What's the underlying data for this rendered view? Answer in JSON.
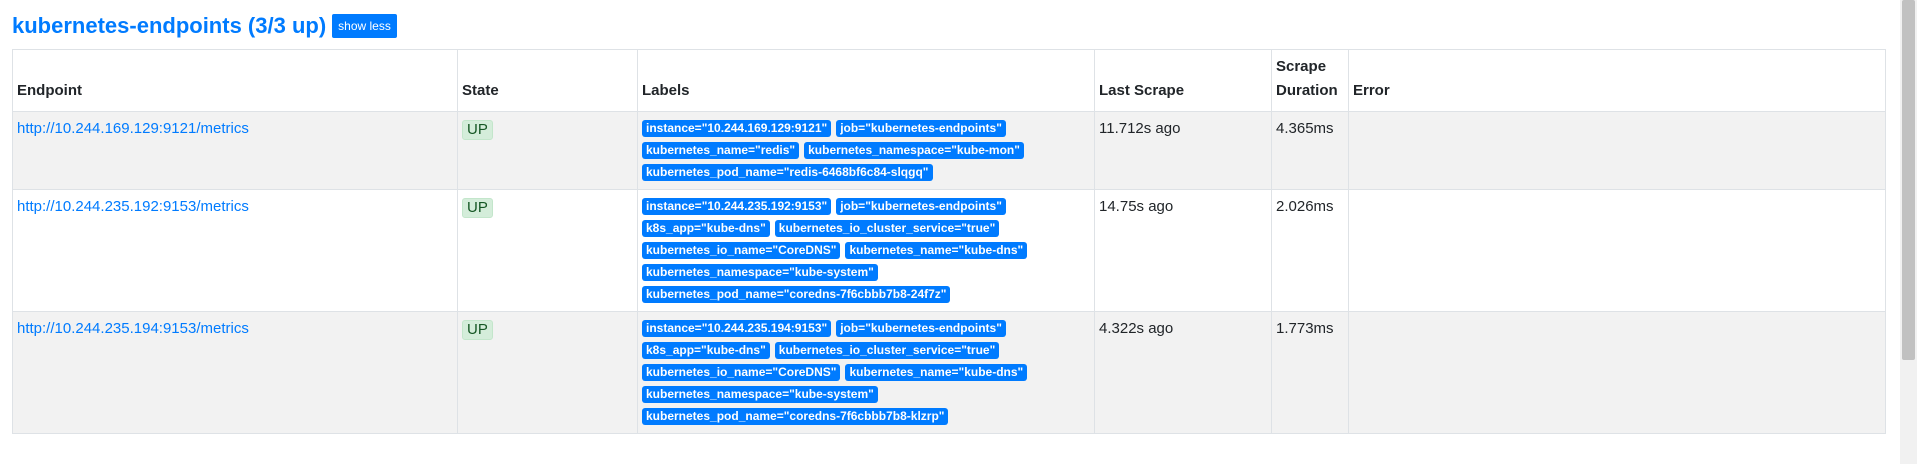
{
  "pool": {
    "title": "kubernetes-endpoints (3/3 up)",
    "toggle_label": "show less"
  },
  "table": {
    "headers": {
      "endpoint": "Endpoint",
      "state": "State",
      "labels": "Labels",
      "last_scrape": "Last Scrape",
      "scrape_duration_line1": "Scrape",
      "scrape_duration_line2": "Duration",
      "error": "Error"
    },
    "rows": [
      {
        "endpoint": "http://10.244.169.129:9121/metrics",
        "state": "UP",
        "labels": [
          "instance=\"10.244.169.129:9121\"",
          "job=\"kubernetes-endpoints\"",
          "kubernetes_name=\"redis\"",
          "kubernetes_namespace=\"kube-mon\"",
          "kubernetes_pod_name=\"redis-6468bf6c84-slqgq\""
        ],
        "last_scrape": "11.712s ago",
        "scrape_duration": "4.365ms",
        "error": ""
      },
      {
        "endpoint": "http://10.244.235.192:9153/metrics",
        "state": "UP",
        "labels": [
          "instance=\"10.244.235.192:9153\"",
          "job=\"kubernetes-endpoints\"",
          "k8s_app=\"kube-dns\"",
          "kubernetes_io_cluster_service=\"true\"",
          "kubernetes_io_name=\"CoreDNS\"",
          "kubernetes_name=\"kube-dns\"",
          "kubernetes_namespace=\"kube-system\"",
          "kubernetes_pod_name=\"coredns-7f6cbbb7b8-24f7z\""
        ],
        "last_scrape": "14.75s ago",
        "scrape_duration": "2.026ms",
        "error": ""
      },
      {
        "endpoint": "http://10.244.235.194:9153/metrics",
        "state": "UP",
        "labels": [
          "instance=\"10.244.235.194:9153\"",
          "job=\"kubernetes-endpoints\"",
          "k8s_app=\"kube-dns\"",
          "kubernetes_io_cluster_service=\"true\"",
          "kubernetes_io_name=\"CoreDNS\"",
          "kubernetes_name=\"kube-dns\"",
          "kubernetes_namespace=\"kube-system\"",
          "kubernetes_pod_name=\"coredns-7f6cbbb7b8-klzrp\""
        ],
        "last_scrape": "4.322s ago",
        "scrape_duration": "1.773ms",
        "error": ""
      }
    ]
  },
  "colors": {
    "accent": "#007bff",
    "up_badge_bg": "#d4edda",
    "up_badge_text": "#155724",
    "striped_row": "#f2f2f2"
  }
}
